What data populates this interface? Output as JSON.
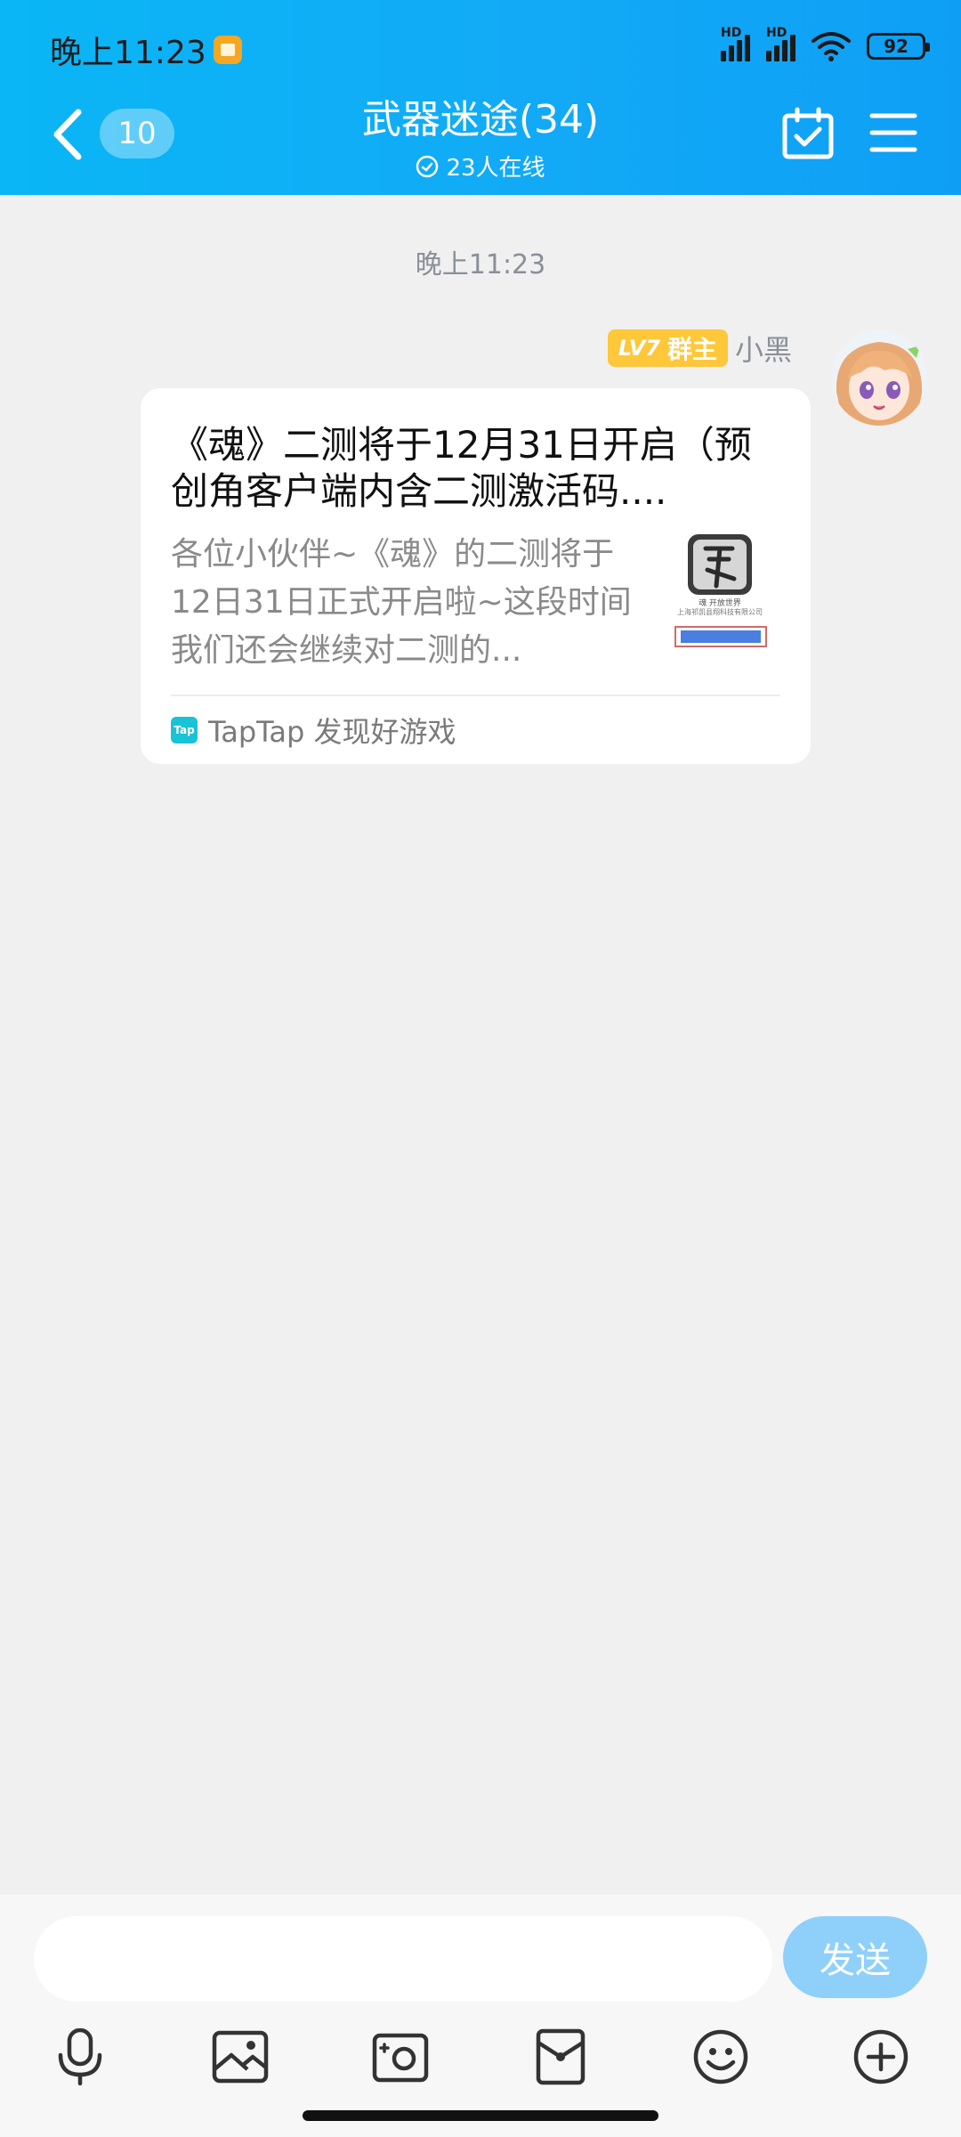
{
  "status_bar": {
    "time": "晚上11:23",
    "signal_1": "HD",
    "signal_2": "HD",
    "battery": "92"
  },
  "header": {
    "unread_count": "10",
    "title": "武器迷途(34)",
    "online": "23人在线"
  },
  "chat": {
    "timestamp": "晚上11:23",
    "message": {
      "level": "LV7",
      "role": "群主",
      "sender": "小黑",
      "card": {
        "title": "《魂》二测将于12月31日开启（预创角客户端内含二测激活码....",
        "description": "各位小伙伴~《魂》的二测将于12日31日正式开启啦~这段时间我们还会继续对二测的...",
        "thumbnail_caption": "魂 开放世界",
        "thumbnail_company": "上海祁凯县翔科技有限公司",
        "source": "TapTap 发现好游戏",
        "source_logo": "Tap"
      }
    }
  },
  "composer": {
    "placeholder": "",
    "send_label": "发送"
  },
  "toolbar": {
    "icons": [
      "microphone-icon",
      "image-icon",
      "camera-icon",
      "red-packet-icon",
      "emoji-icon",
      "plus-icon"
    ]
  },
  "colors": {
    "header_start": "#0ab6f5",
    "header_end": "#0e9ff5",
    "send_button": "#8fd0fb",
    "level_badge": "#ffc73a"
  }
}
